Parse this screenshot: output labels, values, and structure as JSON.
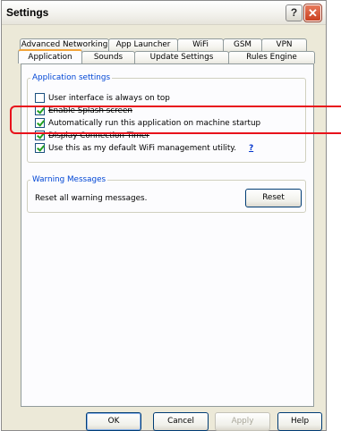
{
  "window": {
    "title": "Settings",
    "help_glyph": "?",
    "close_glyph": "✕"
  },
  "tabs": {
    "back_row": [
      "Advanced Networking",
      "App Launcher",
      "WiFi",
      "GSM",
      "VPN"
    ],
    "front_row": [
      "Application",
      "Sounds",
      "Update Settings",
      "Rules Engine"
    ],
    "active": "Application"
  },
  "application_settings": {
    "legend": "Application settings",
    "options": [
      {
        "label": "User interface is always on top",
        "checked": false
      },
      {
        "label": "Enable Splash screen",
        "checked": true
      },
      {
        "label": "Automatically run this application on machine startup",
        "checked": true
      },
      {
        "label": "Display Connection Timer",
        "checked": true
      },
      {
        "label": "Use this as my default WiFi management utility.",
        "checked": true
      }
    ],
    "help_link": "?"
  },
  "warning_messages": {
    "legend": "Warning Messages",
    "text": "Reset all warning messages.",
    "reset_label": "Reset"
  },
  "footer": {
    "ok": "OK",
    "cancel": "Cancel",
    "apply": "Apply",
    "help": "Help"
  },
  "colors": {
    "accent": "#0046d5",
    "highlight": "#e8121b",
    "active_tab_top": "#f2a43a"
  }
}
